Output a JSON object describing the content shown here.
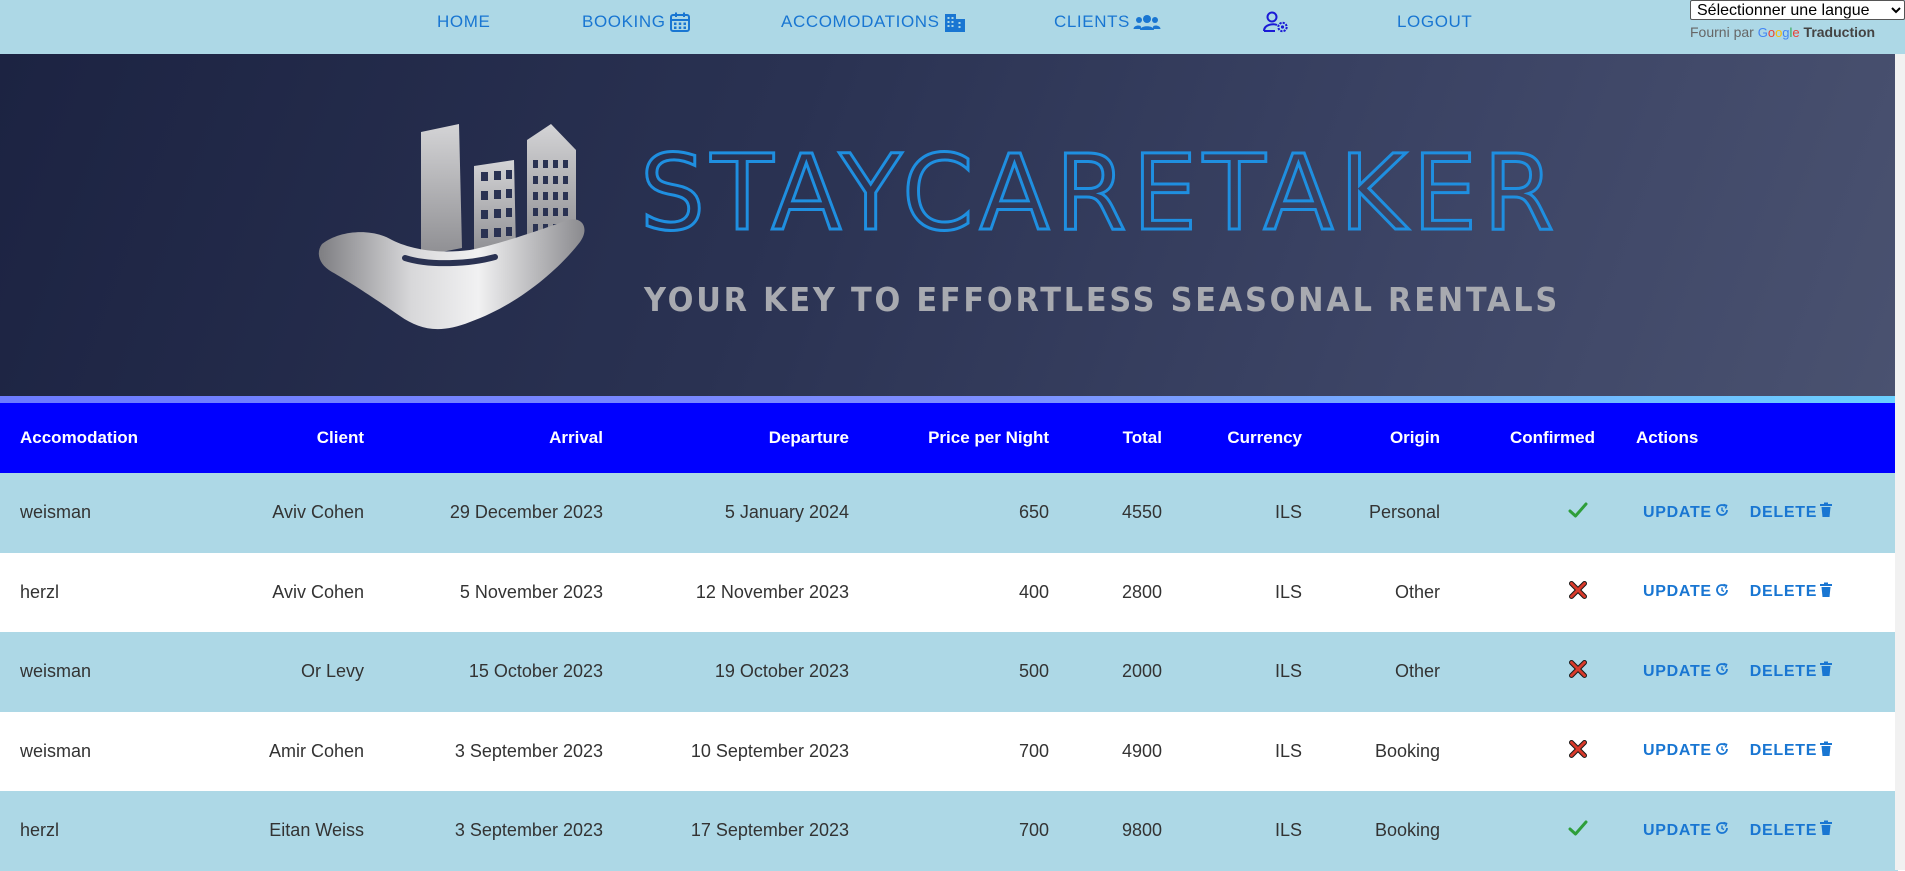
{
  "nav": {
    "home": "HOME",
    "booking": "BOOKING",
    "accomodations": "ACCOMODATIONS",
    "clients": "CLIENTS",
    "logout": "LOGOUT"
  },
  "translate": {
    "select_value": "Sélectionner une langue",
    "powered_by": "Fourni par",
    "google": "Google",
    "translation": "Traduction"
  },
  "hero": {
    "brand": "STAYCARETAKER",
    "tagline": "YOUR KEY TO EFFORTLESS SEASONAL RENTALS"
  },
  "colors": {
    "nav_bg": "#add8e6",
    "accent": "#1976d2",
    "table_header": "#0000ff",
    "row_alt": "#add8e6",
    "check": "#2e9e3a",
    "cross": "#d93a2b"
  },
  "table": {
    "headers": {
      "accomodation": "Accomodation",
      "client": "Client",
      "arrival": "Arrival",
      "departure": "Departure",
      "price_per_night": "Price per Night",
      "total": "Total",
      "currency": "Currency",
      "origin": "Origin",
      "confirmed": "Confirmed",
      "actions": "Actions"
    },
    "update_label": "UPDATE",
    "delete_label": "DELETE",
    "rows": [
      {
        "accomodation": "weisman",
        "client": "Aviv Cohen",
        "arrival": "29 December 2023",
        "departure": "5 January 2024",
        "price": "650",
        "total": "4550",
        "currency": "ILS",
        "origin": "Personal",
        "confirmed": true
      },
      {
        "accomodation": "herzl",
        "client": "Aviv Cohen",
        "arrival": "5 November 2023",
        "departure": "12 November 2023",
        "price": "400",
        "total": "2800",
        "currency": "ILS",
        "origin": "Other",
        "confirmed": false
      },
      {
        "accomodation": "weisman",
        "client": "Or Levy",
        "arrival": "15 October 2023",
        "departure": "19 October 2023",
        "price": "500",
        "total": "2000",
        "currency": "ILS",
        "origin": "Other",
        "confirmed": false
      },
      {
        "accomodation": "weisman",
        "client": "Amir Cohen",
        "arrival": "3 September 2023",
        "departure": "10 September 2023",
        "price": "700",
        "total": "4900",
        "currency": "ILS",
        "origin": "Booking",
        "confirmed": false
      },
      {
        "accomodation": "herzl",
        "client": "Eitan Weiss",
        "arrival": "3 September 2023",
        "departure": "17 September 2023",
        "price": "700",
        "total": "9800",
        "currency": "ILS",
        "origin": "Booking",
        "confirmed": true
      }
    ]
  }
}
